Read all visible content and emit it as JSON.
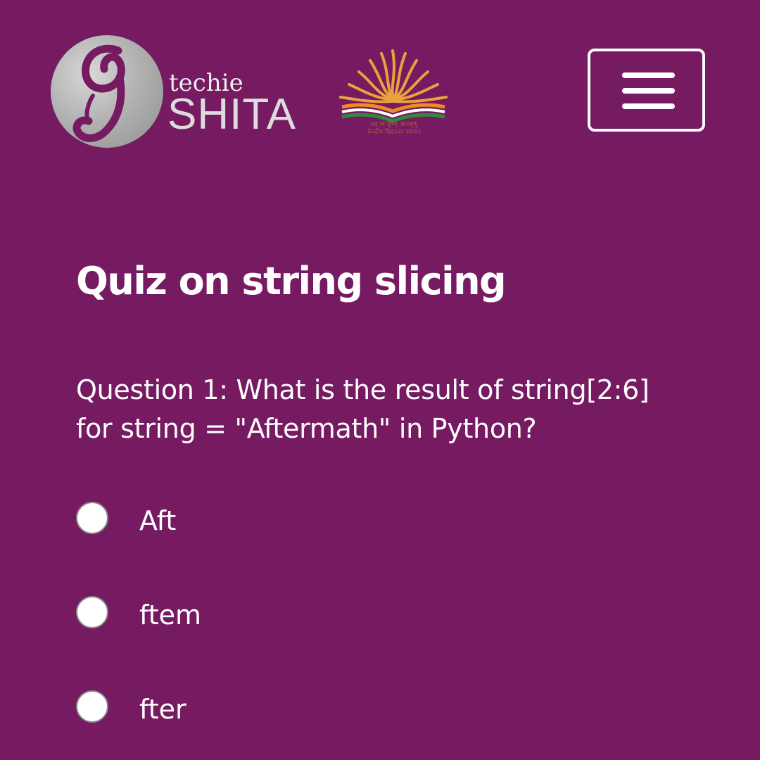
{
  "header": {
    "logo_word_small": "techie",
    "logo_word_large": "SHITA",
    "emblem_motto": "तत् त्वं पूषन् अपावृणु",
    "emblem_name": "केन्द्रीय विद्यालय संगठन",
    "menu_icon": "hamburger-menu-icon"
  },
  "quiz": {
    "title": "Quiz on string slicing",
    "question": "Question 1: What is the result of string[2:6] for string = \"Aftermath\" in Python?",
    "options": [
      {
        "label": "Aft",
        "selected": false
      },
      {
        "label": "ftem",
        "selected": false
      },
      {
        "label": "fter",
        "selected": false
      }
    ]
  },
  "colors": {
    "background": "#761a62",
    "text": "#ffffff",
    "logo_silver": "#b3b3b3",
    "emblem_gold": "#e9a23b",
    "emblem_saffron": "#f08a24",
    "emblem_green": "#2e8b3d"
  }
}
